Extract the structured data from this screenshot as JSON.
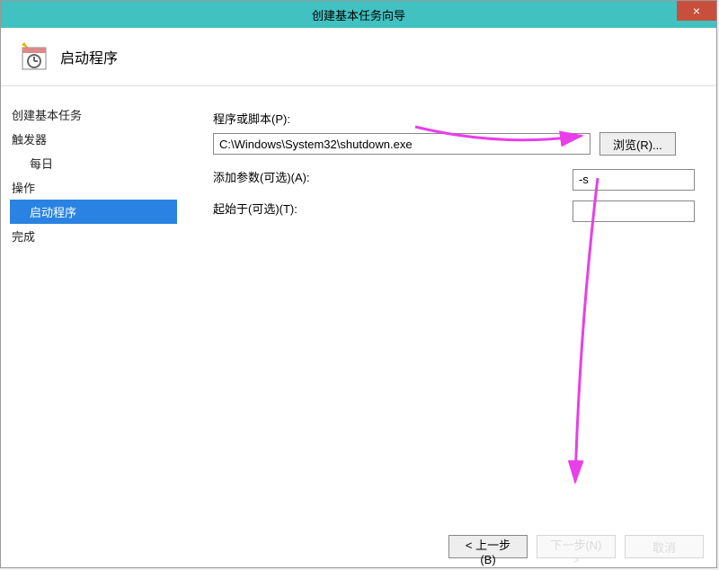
{
  "titlebar": {
    "title": "创建基本任务向导",
    "close": "×"
  },
  "header": {
    "title": "启动程序"
  },
  "sidebar": {
    "items": [
      {
        "label": "创建基本任务",
        "indent": false,
        "selected": false
      },
      {
        "label": "触发器",
        "indent": false,
        "selected": false
      },
      {
        "label": "每日",
        "indent": true,
        "selected": false
      },
      {
        "label": "操作",
        "indent": false,
        "selected": false
      },
      {
        "label": "启动程序",
        "indent": true,
        "selected": true
      },
      {
        "label": "完成",
        "indent": false,
        "selected": false
      }
    ]
  },
  "form": {
    "script_label": "程序或脚本(P):",
    "script_value": "C:\\Windows\\System32\\shutdown.exe",
    "browse_label": "浏览(R)...",
    "args_label": "添加参数(可选)(A):",
    "args_value": "-s",
    "startin_label": "起始于(可选)(T):",
    "startin_value": ""
  },
  "footer": {
    "back": "< 上一步(B)",
    "next": "下一步(N) >",
    "cancel": "取消"
  },
  "annotation_color": "#e83fe8"
}
